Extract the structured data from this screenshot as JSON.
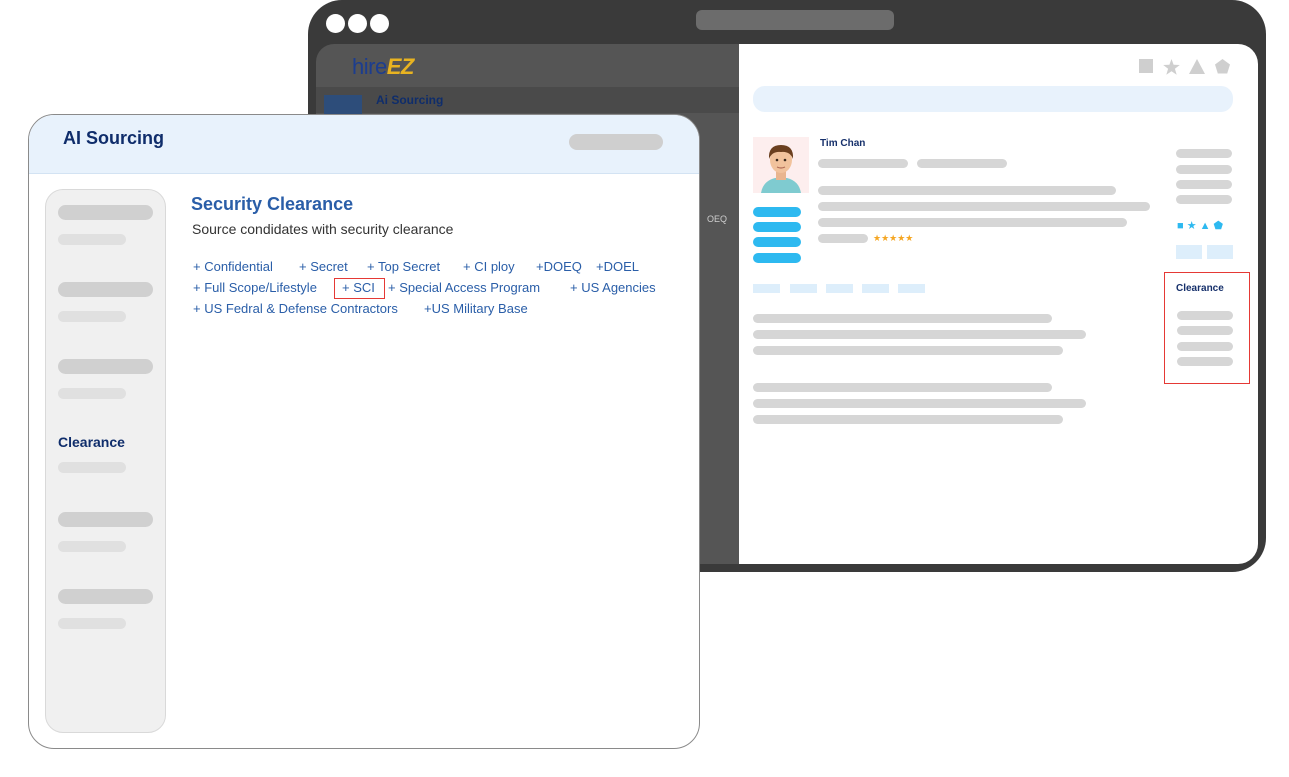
{
  "back_window": {
    "logo": {
      "part1": "hire",
      "part2": "EZ"
    },
    "nav_label": "Ai Sourcing",
    "fragment_text": "OEQ",
    "candidate_name": "Tim Chan",
    "rating_stars": "★★★★★",
    "toolbar_icons": [
      "square-icon",
      "star-icon",
      "triangle-icon",
      "pentagon-icon"
    ],
    "shape_row": "■ ★ ▲ ⬟",
    "clearance_label": "Clearance"
  },
  "front_window": {
    "title": "AI Sourcing",
    "sidebar": {
      "active_label": "Clearance"
    },
    "section": {
      "title": "Security Clearance",
      "subtitle": "Source condidates with security clearance"
    },
    "options": [
      "+ Confidential",
      "+ Secret",
      "+ Top Secret",
      "+ CI ploy",
      "+DOEQ",
      "+DOEL",
      "+ Full Scope/Lifestyle",
      "+ SCI",
      "+ Special Access Program",
      "+ US Agencies",
      "+ US Fedral & Defense Contractors",
      "+US Military Base"
    ],
    "highlighted_option": "+ SCI"
  },
  "colors": {
    "brand_navy": "#0f2d6b",
    "link_blue": "#2a5ea8",
    "accent_cyan": "#2db9f0",
    "highlight_red": "#e53935",
    "logo_gold": "#e8b321"
  }
}
